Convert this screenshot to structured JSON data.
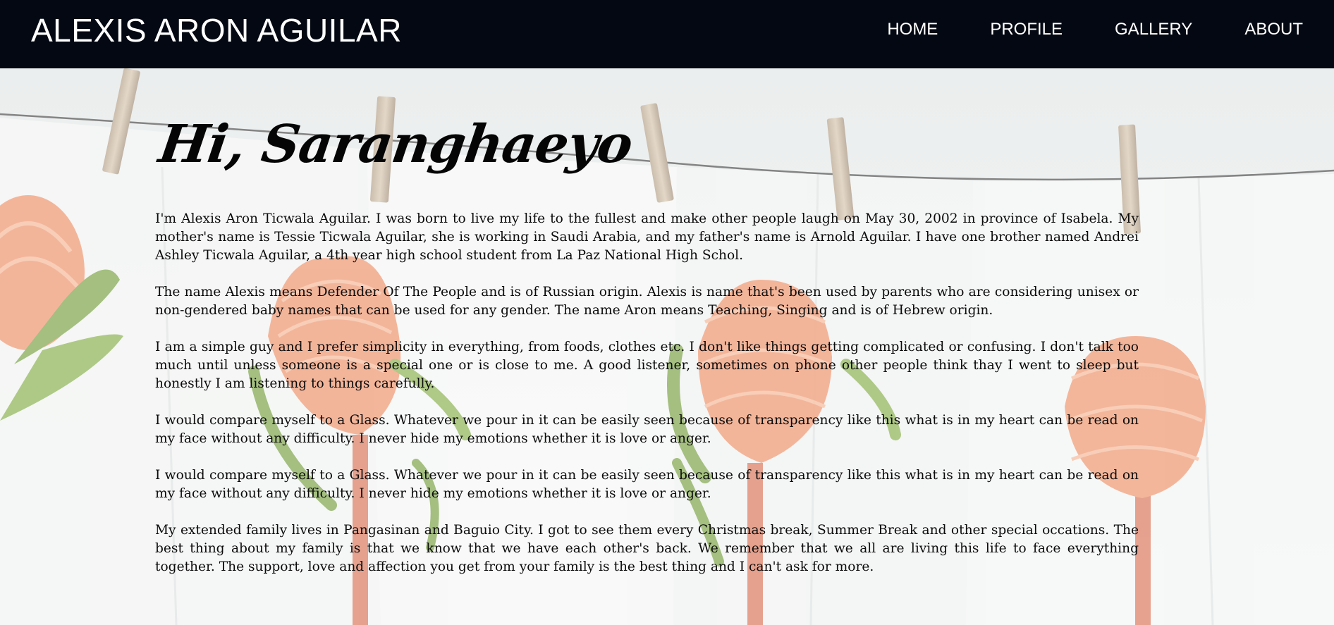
{
  "header": {
    "brand": "ALEXIS ARON AGUILAR",
    "nav": [
      "HOME",
      "PROFILE",
      "GALLERY",
      "ABOUT"
    ]
  },
  "main": {
    "greeting": "Hi, Saranghaeyo",
    "paragraphs": [
      "I'm Alexis Aron Ticwala Aguilar. I was born to live my life to the fullest and make other people laugh on May 30, 2002 in province of Isabela. My mother's name is Tessie Ticwala Aguilar, she is working in Saudi Arabia, and my father's name is Arnold Aguilar. I have one brother named Andrei Ashley Ticwala Aguilar, a 4th year high school student from La Paz National High Schol.",
      "The name Alexis means Defender Of The People and is of Russian origin. Alexis is name that's been used by parents who are considering unisex or non-gendered baby names that can be used for any gender. The name Aron means Teaching, Singing and is of Hebrew origin.",
      "I am a simple guy and I prefer simplicity in everything, from foods, clothes etc. I don't like things getting complicated or confusing. I don't talk too much until unless someone is a special one or is close to me. A good listener, sometimes on phone other people think thay I went to sleep but honestly I am listening to things carefully.",
      "I would compare myself to a Glass. Whatever we pour in it can be easily seen because of transparency like this what is in my heart can be read on my face without any difficulty. I never hide my emotions whether it is love or anger.",
      "I would compare myself to a Glass. Whatever we pour in it can be easily seen because of transparency like this what is in my heart can be read on my face without any difficulty. I never hide my emotions whether it is love or anger.",
      "My extended family lives in Pangasinan and Baguio City. I got to see them every Christmas break, Summer Break and other special occations. The best thing about my family is that we know that we have each other's back. We remember that we all are living this life to face everything together. The support, love and affection you get from your family is the best thing and I can't ask for more."
    ]
  },
  "colors": {
    "header_bg": "#030812",
    "header_text": "#ffffff",
    "body_text": "#0b0b0b",
    "flower": "#ef8a5e",
    "leaf": "#6f9a34"
  }
}
